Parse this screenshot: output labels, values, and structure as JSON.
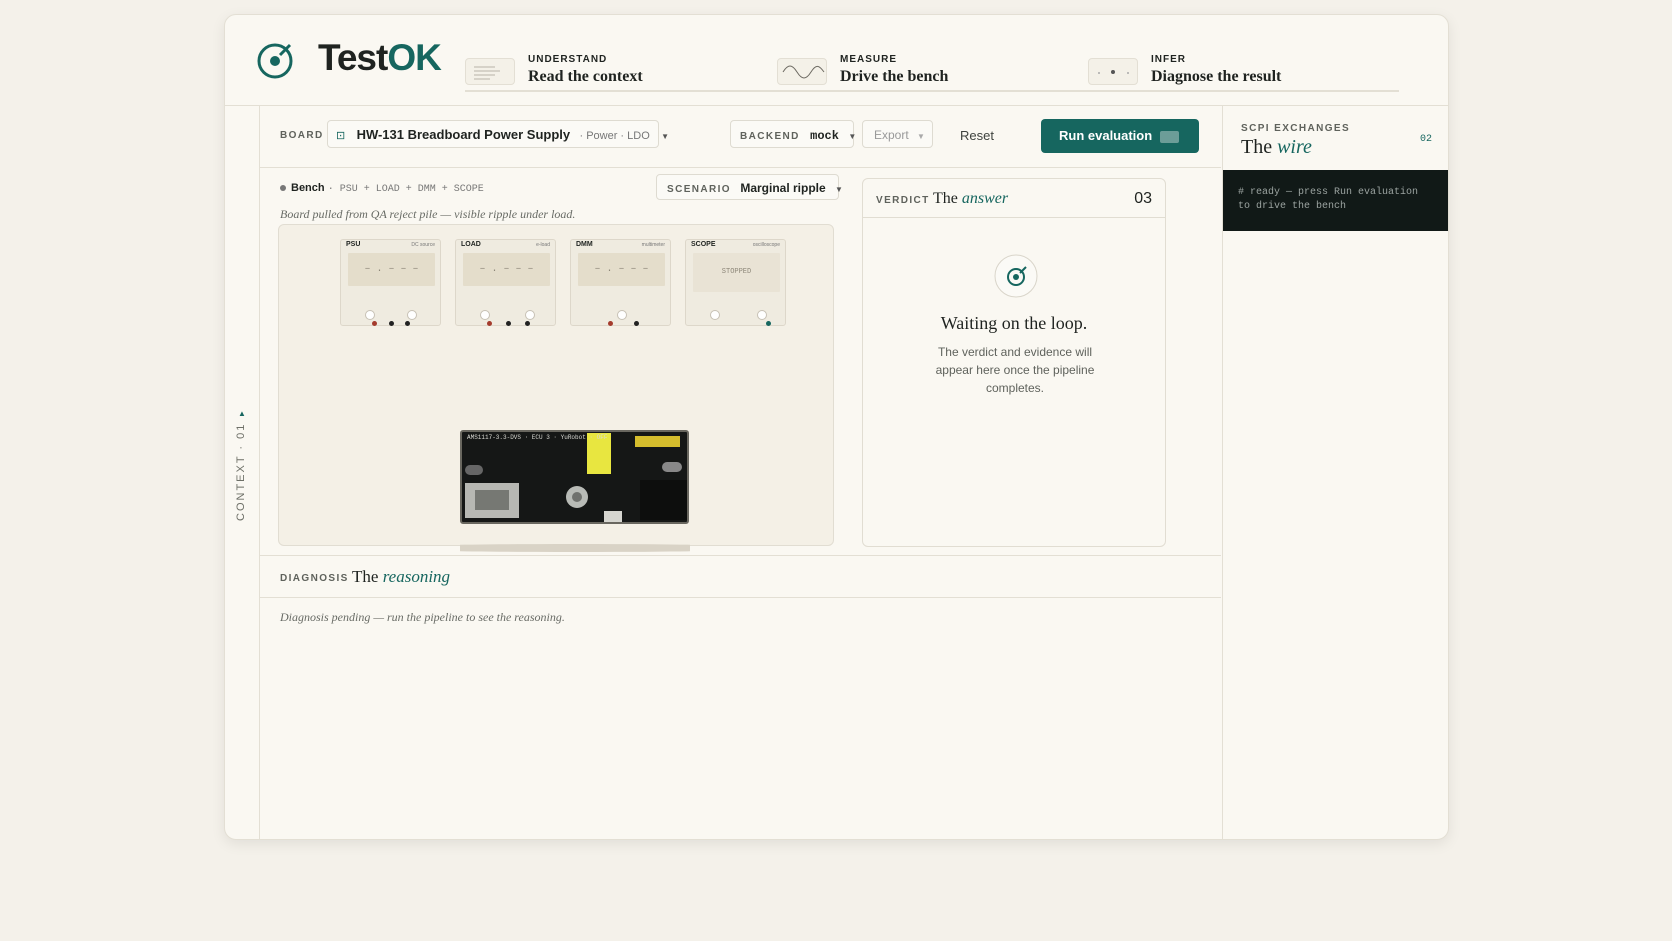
{
  "app": {
    "logo_primary": "Test",
    "logo_accent": "OK"
  },
  "steps": [
    {
      "kicker": "UNDERSTAND",
      "title": "Read the context",
      "icon": "document-lines-icon"
    },
    {
      "kicker": "MEASURE",
      "title": "Drive the bench",
      "icon": "waveform-icon"
    },
    {
      "kicker": "INFER",
      "title": "Diagnose the result",
      "icon": "dots-icon"
    }
  ],
  "rail": {
    "label": "CONTEXT · 01"
  },
  "toolbar": {
    "board_label": "BOARD",
    "board_name": "HW-131 Breadboard Power Supply",
    "board_meta": "· Power · LDO",
    "backend_label": "BACKEND",
    "backend_value": "mock",
    "export_label": "Export",
    "reset_label": "Reset",
    "run_label": "Run evaluation"
  },
  "bench": {
    "title": "Bench",
    "parts": "· PSU + LOAD + DMM + SCOPE",
    "scenario_label": "SCENARIO",
    "scenario_value": "Marginal ripple",
    "note": "Board pulled from QA reject pile — visible ripple under load.",
    "instruments": [
      {
        "name": "PSU",
        "sub": "DC source",
        "display": "– . – – –"
      },
      {
        "name": "LOAD",
        "sub": "e-load",
        "display": "– . – – –"
      },
      {
        "name": "DMM",
        "sub": "multimeter",
        "display": "– . – – –"
      },
      {
        "name": "SCOPE",
        "sub": "oscilloscope",
        "display": "STOPPED"
      }
    ],
    "board_silk": "AMS1117-3.3-DVS · ECU 3 · YuRobot · OFF"
  },
  "verdict": {
    "label": "VERDICT",
    "title_prefix": "The",
    "title_accent": "answer",
    "number": "03",
    "wait_title": "Waiting on the loop.",
    "wait_text": "The verdict and evidence will appear here once the pipeline completes."
  },
  "diagnosis": {
    "label": "DIAGNOSIS",
    "title_prefix": "The",
    "title_accent": "reasoning",
    "pending": "Diagnosis pending — run the pipeline to see the reasoning."
  },
  "scpi": {
    "label": "SCPI EXCHANGES",
    "title_prefix": "The",
    "title_accent": "wire",
    "number": "02",
    "terminal": "# ready — press Run evaluation to drive the bench"
  },
  "colors": {
    "accent": "#16665f",
    "terminal_bg": "#111917",
    "panel": "#faf8f2"
  }
}
